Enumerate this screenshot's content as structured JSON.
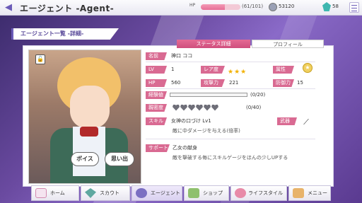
{
  "header": {
    "title": "エージェント -Agent-",
    "hp_label": "HP",
    "hp_value": "(61/101)",
    "hp_fraction": 0.604,
    "coins": "53120",
    "gems": "58"
  },
  "section": {
    "title": "エージェント一覧 -詳細-"
  },
  "tabs": [
    {
      "label": "ステータス詳細",
      "active": true
    },
    {
      "label": "プロフィール",
      "active": false
    }
  ],
  "portrait": {
    "voice_button": "ボイス",
    "memory_button": "思い出"
  },
  "stats": {
    "name_label": "名前",
    "name": "神口 ココ",
    "lv_label": "LV",
    "lv": "1",
    "rarity_label": "レア度",
    "rarity_stars": "★★★",
    "attr_label": "属性",
    "hp_label": "HP",
    "hp": "560",
    "atk_label": "攻撃力",
    "atk": "221",
    "def_label": "防御力",
    "def": "15",
    "exp_label": "経験値",
    "exp": "(0/20)",
    "affection_label": "親密度",
    "affection": "(0/40)",
    "skill_label": "スキル",
    "skill_name": "女神の口づけ Lv1",
    "skill_desc": "敵に中ダメージを与える(倍率)",
    "weapon_label": "武器",
    "support_label": "サポート",
    "support_name": "乙女の献身",
    "support_desc": "敵を撃破する毎にスキルゲージをほんの少しUPする"
  },
  "nav": [
    {
      "label": "ホーム"
    },
    {
      "label": "スカウト"
    },
    {
      "label": "エージェント"
    },
    {
      "label": "ショップ"
    },
    {
      "label": "ライフスタイル"
    },
    {
      "label": "メニュー"
    }
  ],
  "colors": {
    "accent": "#6b5bb8",
    "pink": "#d96a92",
    "gem": "#3fb7b0",
    "star": "#f2b100"
  }
}
